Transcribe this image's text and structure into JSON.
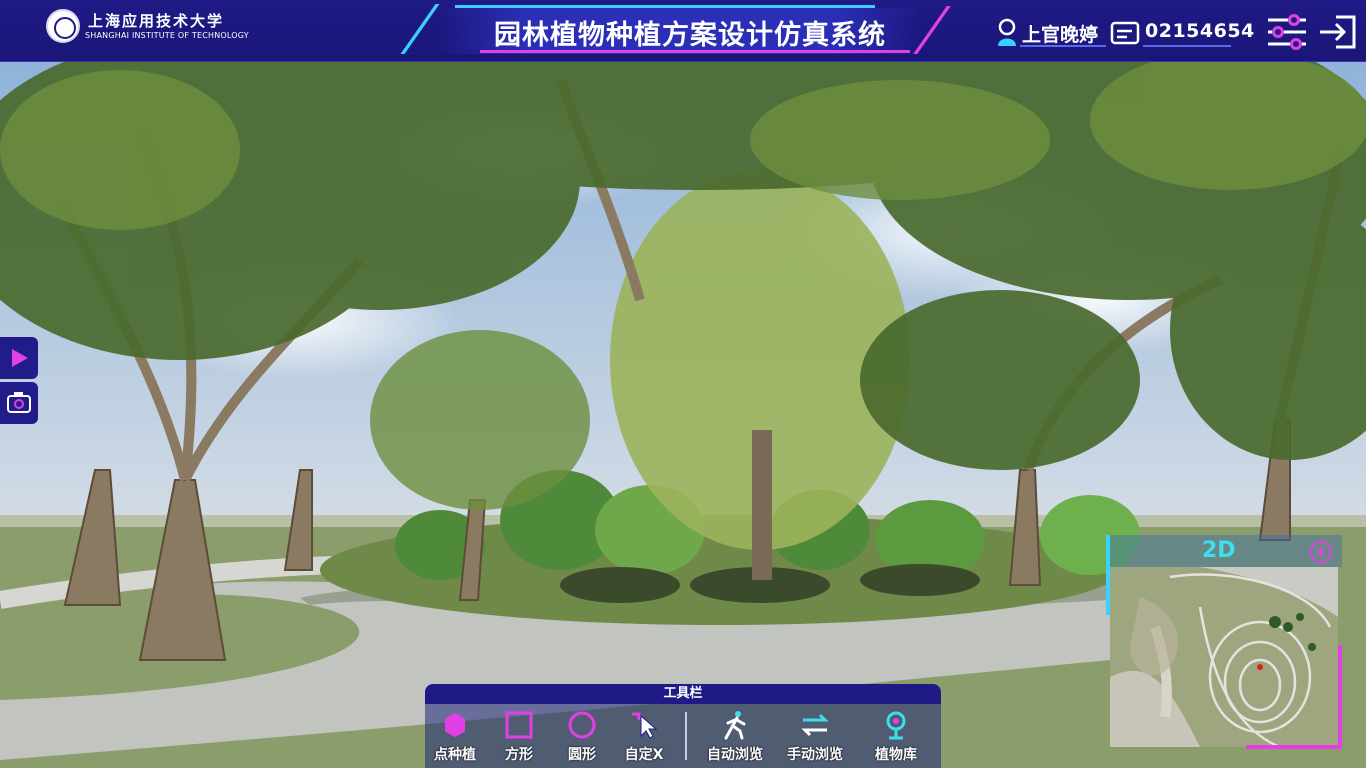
{
  "header": {
    "school_name_cn": "上海应用技术大学",
    "school_name_en": "SHANGHAI INSTITUTE OF TECHNOLOGY",
    "title": "园林植物种植方案设计仿真系统",
    "user_name": "上官晚婷",
    "user_id": "02154654",
    "icons": {
      "user": "user-icon",
      "id": "id-card-icon",
      "settings": "sliders-settings-icon",
      "logout": "logout-icon"
    }
  },
  "side_buttons": [
    {
      "icon": "play-icon"
    },
    {
      "icon": "camera-icon"
    }
  ],
  "minimap": {
    "mode_label": "2D",
    "zoom_icon": "zoom-in-icon"
  },
  "toolbar": {
    "title": "工具栏",
    "tools": [
      {
        "label": "点种植",
        "icon": "point-plant-icon"
      },
      {
        "label": "方形",
        "icon": "square-icon"
      },
      {
        "label": "圆形",
        "icon": "circle-icon"
      },
      {
        "label": "自定X",
        "icon": "custom-select-icon"
      },
      {
        "label": "自动浏览",
        "icon": "walking-person-icon"
      },
      {
        "label": "手动浏览",
        "icon": "swap-arrows-icon"
      },
      {
        "label": "植物库",
        "icon": "tree-library-icon"
      }
    ]
  },
  "colors": {
    "header_bg": "#1f1a86",
    "accent_cyan": "#3ad0ff",
    "accent_magenta": "#e23fe4"
  }
}
